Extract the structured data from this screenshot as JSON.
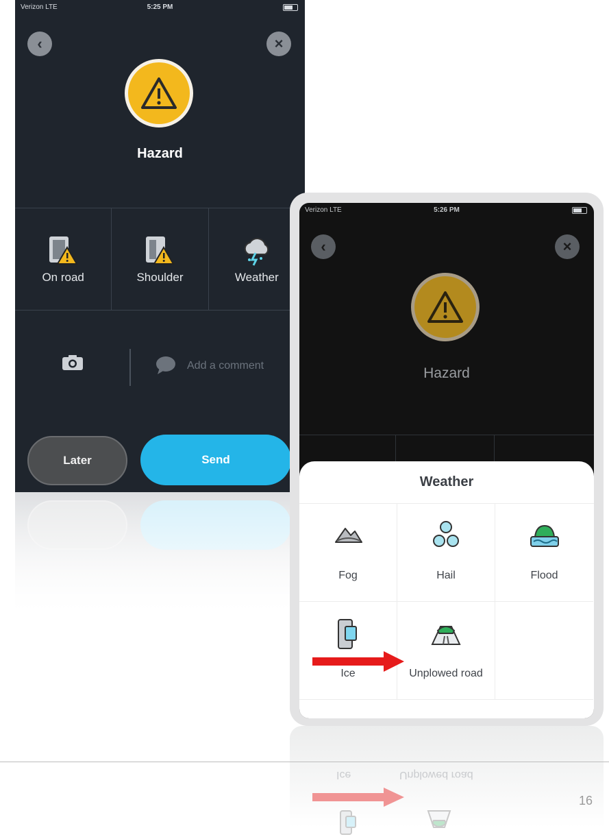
{
  "screen1": {
    "status": {
      "carrier": "Verizon  LTE",
      "time": "5:25 PM"
    },
    "back_glyph": "‹",
    "close_glyph": "×",
    "title": "Hazard",
    "categories": [
      {
        "label": "On road",
        "icon": "road-warning-icon"
      },
      {
        "label": "Shoulder",
        "icon": "shoulder-warning-icon"
      },
      {
        "label": "Weather",
        "icon": "storm-cloud-icon"
      }
    ],
    "comment_placeholder": "Add a comment",
    "later_label": "Later",
    "send_label": "Send"
  },
  "screen2": {
    "status": {
      "carrier": "Verizon  LTE",
      "time": "5:26 PM"
    },
    "back_glyph": "‹",
    "close_glyph": "×",
    "title": "Hazard",
    "sheet_title": "Weather",
    "options": [
      {
        "label": "Fog",
        "icon": "fog-icon"
      },
      {
        "label": "Hail",
        "icon": "hail-icon"
      },
      {
        "label": "Flood",
        "icon": "flood-icon"
      },
      {
        "label": "Ice",
        "icon": "ice-icon"
      },
      {
        "label": "Unplowed road",
        "icon": "unplowed-road-icon"
      }
    ]
  },
  "colors": {
    "accent_blue": "#24b5e8",
    "hazard_yellow": "#f3b81d",
    "arrow_red": "#e61b1b",
    "dark_bg": "#1f252d"
  },
  "page_number": "16"
}
